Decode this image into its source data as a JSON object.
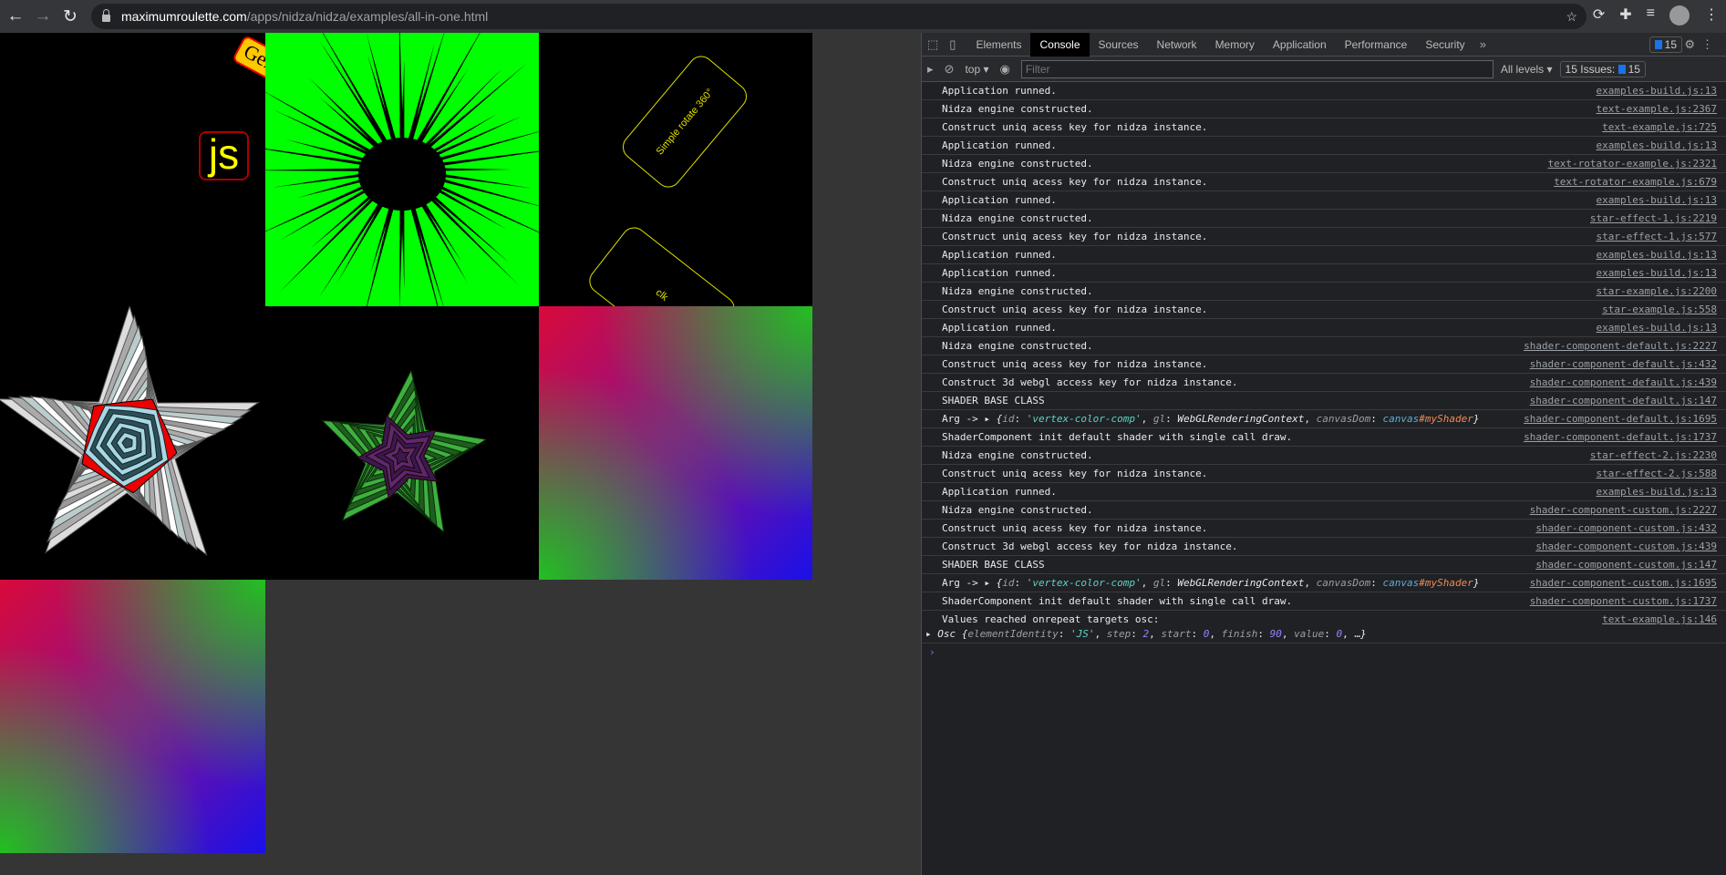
{
  "browser": {
    "url_host": "maximumroulette.com",
    "url_path": "/apps/nidza/nidza/examples/all-in-one.html"
  },
  "canvas": {
    "js_label": "js",
    "gen_label": "Gen",
    "rotate_label": "Simple rotate 360°",
    "click_label": "clk"
  },
  "devtools": {
    "tabs": [
      "Elements",
      "Console",
      "Sources",
      "Network",
      "Memory",
      "Application",
      "Performance",
      "Security"
    ],
    "active_tab": "Console",
    "more": "»",
    "messages_badge": "15",
    "context": "top",
    "filter_placeholder": "Filter",
    "levels": "All levels",
    "issues_label": "15 Issues:",
    "issues_count": "15"
  },
  "console": [
    {
      "msg": "Application runned.",
      "src": "examples-build.js:13"
    },
    {
      "msg": "Nidza engine constructed.",
      "src": "text-example.js:2367"
    },
    {
      "msg": "Construct uniq acess key for nidza instance.",
      "src": "text-example.js:725"
    },
    {
      "msg": "Application runned.",
      "src": "examples-build.js:13"
    },
    {
      "msg": "Nidza engine constructed.",
      "src": "text-rotator-example.js:2321"
    },
    {
      "msg": "Construct uniq acess key for nidza instance.",
      "src": "text-rotator-example.js:679"
    },
    {
      "msg": "Application runned.",
      "src": "examples-build.js:13"
    },
    {
      "msg": "Nidza engine constructed.",
      "src": "star-effect-1.js:2219"
    },
    {
      "msg": "Construct uniq acess key for nidza instance.",
      "src": "star-effect-1.js:577"
    },
    {
      "msg": "Application runned.",
      "src": "examples-build.js:13"
    },
    {
      "msg": "Application runned.",
      "src": "examples-build.js:13"
    },
    {
      "msg": "Nidza engine constructed.",
      "src": "star-example.js:2200"
    },
    {
      "msg": "Construct uniq acess key for nidza instance.",
      "src": "star-example.js:558"
    },
    {
      "msg": "Application runned.",
      "src": "examples-build.js:13"
    },
    {
      "msg": "Nidza engine constructed.",
      "src": "shader-component-default.js:2227"
    },
    {
      "msg": "Construct uniq acess key for nidza instance.",
      "src": "shader-component-default.js:432"
    },
    {
      "msg": "Construct 3d webgl access key for nidza instance.",
      "src": "shader-component-default.js:439"
    },
    {
      "msg": "SHADER BASE CLASS",
      "src": "shader-component-default.js:147"
    },
    {
      "msg": "Arg -> ",
      "obj": true,
      "src": "shader-component-default.js:1695"
    },
    {
      "msg": "ShaderComponent init default shader with single call draw.",
      "src": "shader-component-default.js:1737"
    },
    {
      "msg": "Nidza engine constructed.",
      "src": "star-effect-2.js:2230"
    },
    {
      "msg": "Construct uniq acess key for nidza instance.",
      "src": "star-effect-2.js:588"
    },
    {
      "msg": "Application runned.",
      "src": "examples-build.js:13"
    },
    {
      "msg": "Nidza engine constructed.",
      "src": "shader-component-custom.js:2227"
    },
    {
      "msg": "Construct uniq acess key for nidza instance.",
      "src": "shader-component-custom.js:432"
    },
    {
      "msg": "Construct 3d webgl access key for nidza instance.",
      "src": "shader-component-custom.js:439"
    },
    {
      "msg": "SHADER BASE CLASS",
      "src": "shader-component-custom.js:147"
    },
    {
      "msg": "Arg -> ",
      "obj": true,
      "src": "shader-component-custom.js:1695"
    },
    {
      "msg": "ShaderComponent init default shader with single call draw.",
      "src": "shader-component-custom.js:1737"
    }
  ],
  "arg_object": {
    "id_key": "id",
    "id_val": "'vertex-color-comp'",
    "gl_key": "gl",
    "gl_val": "WebGLRenderingContext",
    "dom_key": "canvasDom",
    "dom_tag": "canvas",
    "dom_id": "#myShader"
  },
  "last_log": {
    "msg": "Values reached onrepeat targets osc:",
    "src": "text-example.js:146",
    "obj_name": "Osc",
    "k1": "elementIdentity",
    "v1": "'JS'",
    "k2": "step",
    "v2": "2",
    "k3": "start",
    "v3": "0",
    "k4": "finish",
    "v4": "90",
    "k5": "value",
    "v5": "0"
  },
  "colors": {
    "green": "#00ff00",
    "yellow": "#ffff00",
    "link": "#9aa0a6"
  }
}
